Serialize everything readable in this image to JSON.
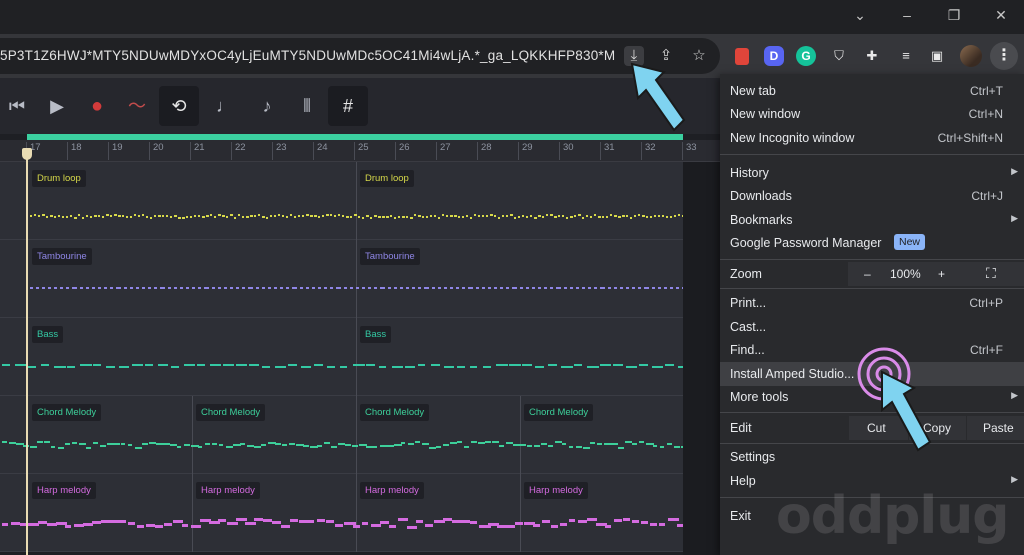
{
  "browser": {
    "url": "5P3T1Z6HWJ*MTY5NDUwMDYxOC4yLjEuMTY5NDUwMDc5OC41Mi4wLjA.*_ga_LQKKHFP830*M...",
    "window_controls": [
      "⌄",
      "–",
      "❐",
      "✕"
    ]
  },
  "daw": {
    "ruler_ticks": [
      "17",
      "18",
      "19",
      "20",
      "21",
      "22",
      "23",
      "24",
      "25",
      "26",
      "27",
      "28",
      "29",
      "30",
      "31",
      "32",
      "33"
    ],
    "tracks": [
      {
        "clips": [
          "Drum loop",
          "Drum loop"
        ],
        "color": "#d6d84a"
      },
      {
        "clips": [
          "Tambourine",
          "Tambourine"
        ],
        "color": "#8f86e6"
      },
      {
        "clips": [
          "Bass",
          "Bass"
        ],
        "color": "#34c9a4"
      },
      {
        "clips": [
          "Chord Melody",
          "Chord Melody",
          "Chord Melody",
          "Chord Melody"
        ],
        "color": "#3dcf9a"
      },
      {
        "clips": [
          "Harp melody",
          "Harp melody",
          "Harp melody",
          "Harp melody"
        ],
        "color": "#d46be0"
      }
    ]
  },
  "menu": {
    "new_tab": "New tab",
    "new_tab_sc": "Ctrl+T",
    "new_window": "New window",
    "new_window_sc": "Ctrl+N",
    "new_incognito": "New Incognito window",
    "new_incognito_sc": "Ctrl+Shift+N",
    "history": "History",
    "downloads": "Downloads",
    "downloads_sc": "Ctrl+J",
    "bookmarks": "Bookmarks",
    "password_manager": "Google Password Manager",
    "new_badge": "New",
    "zoom": "Zoom",
    "zoom_minus": "–",
    "zoom_value": "100%",
    "zoom_plus": "+",
    "print": "Print...",
    "print_sc": "Ctrl+P",
    "cast": "Cast...",
    "find": "Find...",
    "find_sc": "Ctrl+F",
    "install": "Install Amped Studio...",
    "more_tools": "More tools",
    "edit": "Edit",
    "cut": "Cut",
    "copy": "Copy",
    "paste": "Paste",
    "settings": "Settings",
    "help": "Help",
    "exit": "Exit"
  },
  "watermark": "oddplug",
  "colors": {
    "accent": "#3bd0a0",
    "arrow": "#7fd3f0",
    "ripple": "#d98be8"
  }
}
